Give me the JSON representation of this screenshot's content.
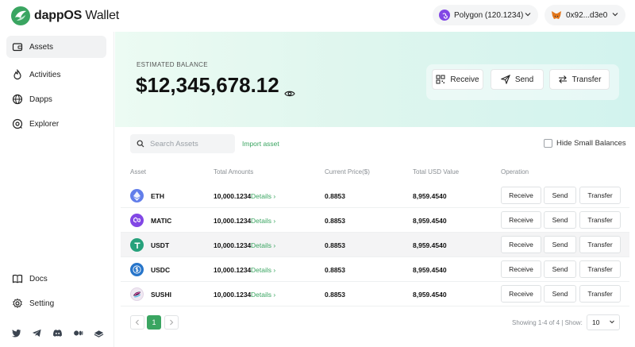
{
  "app": {
    "logo_bold": "dappOS",
    "logo_light": " Wallet"
  },
  "network": {
    "label": "Polygon (120.1234)"
  },
  "account": {
    "label": "0x92...d3e0"
  },
  "sidebar": {
    "items": [
      {
        "label": "Assets",
        "icon": "wallet-icon"
      },
      {
        "label": "Activities",
        "icon": "flame-icon"
      },
      {
        "label": "Dapps",
        "icon": "globe-icon"
      },
      {
        "label": "Explorer",
        "icon": "compass-icon"
      }
    ],
    "bottom": [
      {
        "label": "Docs",
        "icon": "book-icon"
      },
      {
        "label": "Setting",
        "icon": "gear-icon"
      }
    ],
    "social": [
      "twitter-icon",
      "telegram-icon",
      "discord-icon",
      "medium-icon",
      "gitbook-icon"
    ]
  },
  "hero": {
    "label": "ESTIMATED BALANCE",
    "balance": "$12,345,678.12",
    "buttons": {
      "receive": "Receive",
      "send": "Send",
      "transfer": "Transfer"
    }
  },
  "toolbar": {
    "search_placeholder": "Search Assets",
    "import": "Import asset",
    "hide_small": "Hide Small Balances"
  },
  "table": {
    "headers": [
      "Asset",
      "Total Amounts",
      "Current Price($)",
      "Total USD Value",
      "Operation"
    ],
    "details_label": "Details",
    "ops": {
      "receive": "Receive",
      "send": "Send",
      "transfer": "Transfer"
    },
    "rows": [
      {
        "symbol": "ETH",
        "amount": "10,000.1234",
        "price": "0.8853",
        "usd": "8,959.4540",
        "color": "#627eea"
      },
      {
        "symbol": "MATIC",
        "amount": "10,000.1234",
        "price": "0.8853",
        "usd": "8,959.4540",
        "color": "#8247e5"
      },
      {
        "symbol": "USDT",
        "amount": "10,000.1234",
        "price": "0.8853",
        "usd": "8,959.4540",
        "color": "#26a17b"
      },
      {
        "symbol": "USDC",
        "amount": "10,000.1234",
        "price": "0.8853",
        "usd": "8,959.4540",
        "color": "#2775ca"
      },
      {
        "symbol": "SUSHI",
        "amount": "10,000.1234",
        "price": "0.8853",
        "usd": "8,959.4540",
        "color": "#d65892"
      }
    ]
  },
  "pagination": {
    "current": "1",
    "showing": "Showing 1-4 of 4 | Show:",
    "per_page": "10"
  },
  "colors": {
    "accent": "#3aa561",
    "polygon": "#8247e5"
  }
}
